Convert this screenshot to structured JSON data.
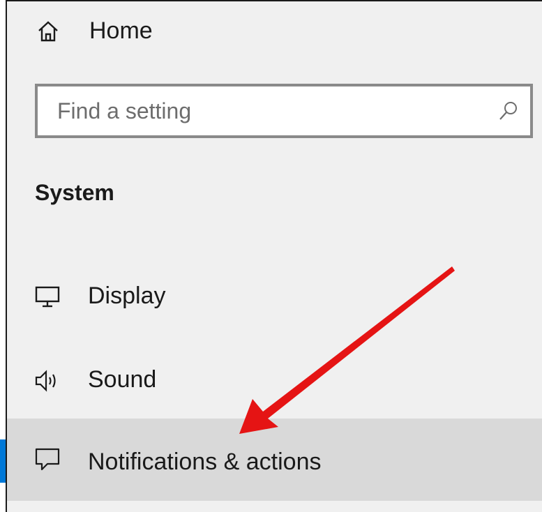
{
  "header": {
    "home_label": "Home"
  },
  "search": {
    "placeholder": "Find a setting"
  },
  "section": {
    "title": "System"
  },
  "nav": {
    "items": [
      {
        "label": "Display",
        "icon": "monitor-icon",
        "selected": false
      },
      {
        "label": "Sound",
        "icon": "speaker-icon",
        "selected": false
      },
      {
        "label": "Notifications & actions",
        "icon": "message-icon",
        "selected": true
      }
    ]
  },
  "colors": {
    "panel_bg": "#f0f0f0",
    "selected_bg": "#d9d9d9",
    "accent": "#0078d7",
    "annotation_arrow": "#e51414"
  }
}
